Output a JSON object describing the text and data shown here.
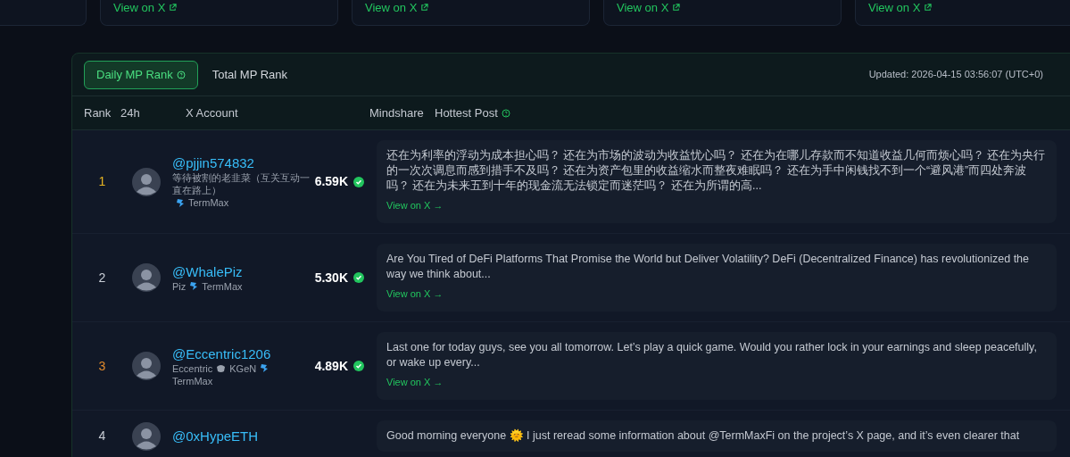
{
  "top_cards": [
    {
      "kind": "edge"
    },
    {
      "kind": "card",
      "link": "View on X"
    },
    {
      "kind": "card",
      "link": "View on X"
    },
    {
      "kind": "card",
      "link": "View on X"
    },
    {
      "kind": "card",
      "link": "View on X"
    }
  ],
  "tabs": [
    {
      "label": "Daily MP Rank",
      "selected": true,
      "help": true
    },
    {
      "label": "Total MP Rank",
      "selected": false,
      "help": false
    }
  ],
  "updated": "Updated: 2026-04-15 03:56:07 (UTC+0)",
  "columns": [
    {
      "label": "Rank",
      "help": false
    },
    {
      "label": "24h",
      "help": false
    },
    {
      "label": "X Account",
      "help": false
    },
    {
      "label": "Mindshare",
      "help": false
    },
    {
      "label": "Hottest Post",
      "help": true
    }
  ],
  "rows": [
    {
      "rank": "1",
      "color": "#e6b422",
      "handle": "@pjjin574832",
      "bio": [
        {
          "kind": "text",
          "text": "等待被割的老韭菜（互关互动一直在路上）"
        },
        {
          "kind": "logo"
        },
        {
          "kind": "text",
          "text": "TermMax"
        }
      ],
      "mindshare": "6.59K",
      "post": "还在为利率的浮动为成本担心吗？ 还在为市场的波动为收益忧心吗？ 还在为在哪儿存款而不知道收益几何而烦心吗？ 还在为央行的一次次调息而感到措手不及吗？ 还在为资产包里的收益缩水而整夜难眠吗？ 还在为手中闲钱找不到一个“避风港”而四处奔波吗？ 还在为未来五到十年的现金流无法锁定而迷茫吗？ 还在为所谓的高...",
      "link": "View on X →"
    },
    {
      "rank": "2",
      "color": "#c9ced6",
      "handle": "@WhalePiz",
      "bio": [
        {
          "kind": "text",
          "text": "Piz"
        },
        {
          "kind": "logo"
        },
        {
          "kind": "text",
          "text": "TermMax"
        }
      ],
      "mindshare": "5.30K",
      "post": "Are You Tired of DeFi Platforms That Promise the World but Deliver Volatility? DeFi (Decentralized Finance) has revolutionized the way we think about...",
      "link": "View on X →"
    },
    {
      "rank": "3",
      "color": "#e08a2c",
      "handle": "@Eccentric1206",
      "bio": [
        {
          "kind": "text",
          "text": "Eccentric"
        },
        {
          "kind": "mask"
        },
        {
          "kind": "text",
          "text": "KGeN"
        },
        {
          "kind": "logo"
        },
        {
          "kind": "text",
          "text": "TermMax"
        }
      ],
      "mindshare": "4.89K",
      "post": "Last one for today guys, see you all tomorrow. Let’s play a quick game. Would you rather lock in your earnings and sleep peacefully, or wake up every...",
      "link": "View on X →"
    },
    {
      "rank": "4",
      "color": "#c9ced6",
      "handle": "@0xHypeETH",
      "post": "Good morning everyone 🌞 I just reread some information about @TermMaxFi on the project’s X page, and it’s even clearer that"
    }
  ]
}
